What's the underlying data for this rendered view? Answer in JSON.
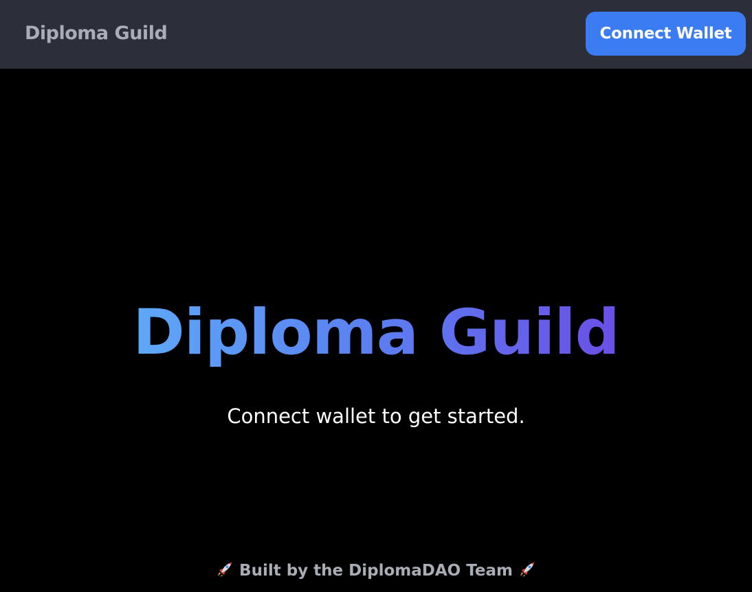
{
  "header": {
    "brand": "Diploma Guild",
    "connect_button_label": "Connect Wallet"
  },
  "hero": {
    "title": "Diploma Guild",
    "subtitle": "Connect wallet to get started."
  },
  "footer": {
    "text": "Built by the DiplomaDAO Team",
    "left_icon": "rocket-icon",
    "right_icon": "rocket-icon"
  },
  "colors": {
    "background": "#000000",
    "navbar": "#2c2f3a",
    "accent": "#3b7cf2",
    "muted_text": "#a9adb6",
    "gradient_start": "#5ea8f8",
    "gradient_end": "#6a4fe6"
  }
}
